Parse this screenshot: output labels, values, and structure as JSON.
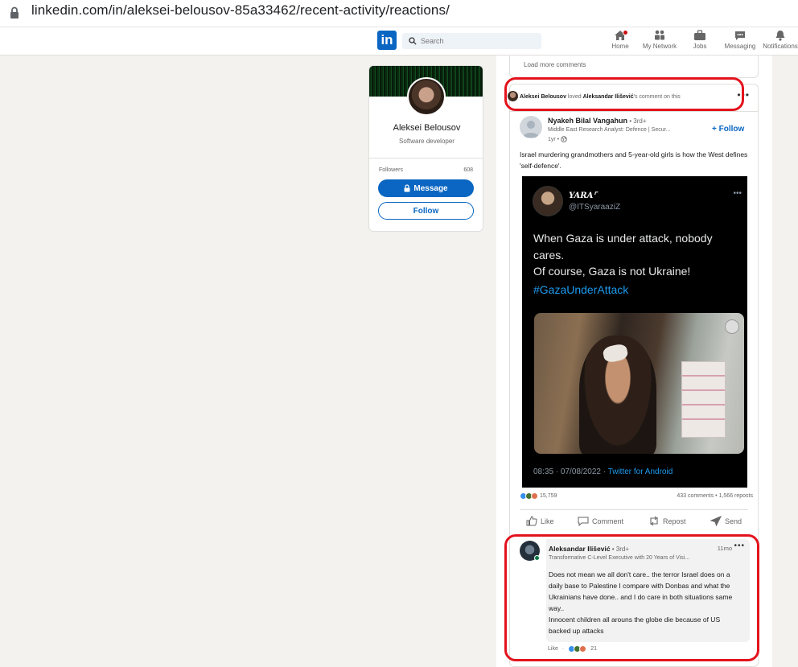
{
  "browser": {
    "url": "linkedin.com/in/aleksei-belousov-85a33462/recent-activity/reactions/"
  },
  "nav": {
    "search_placeholder": "Search",
    "items": [
      {
        "label": "Home",
        "icon": "home-icon"
      },
      {
        "label": "My Network",
        "icon": "network-icon"
      },
      {
        "label": "Jobs",
        "icon": "briefcase-icon"
      },
      {
        "label": "Messaging",
        "icon": "messaging-icon"
      },
      {
        "label": "Notifications",
        "icon": "bell-icon"
      }
    ]
  },
  "profile": {
    "name": "Aleksei Belousov",
    "headline": "Software developer",
    "followers_label": "Followers",
    "followers_count": "608",
    "message_label": "Message",
    "follow_label": "Follow"
  },
  "feed": {
    "load_more": "Load more comments",
    "activity": {
      "actor": "Aleksei Belousov",
      "verb": " loved ",
      "target": "Aleksandar Ilišević",
      "suffix": "'s comment on this"
    },
    "post": {
      "author": "Nyakeh Bilal Vangahun",
      "degree": " • 3rd+",
      "title": "Middle East Research Analyst: Defence | Secur...",
      "time": "1yr •",
      "follow_label": "+ Follow",
      "text": "Israel murdering grandmothers and 5-year-old girls is how the West defines 'self-defence'.",
      "tweet": {
        "name": "YARA⌜",
        "handle": "@ITSyaraaziZ",
        "text": "When Gaza is under attack, nobody cares.\nOf course, Gaza is not Ukraine!",
        "hashtag": "#GazaUnderAttack",
        "timestamp": "08:35 · 07/08/2022 · ",
        "source": "Twitter for Android"
      },
      "reactions_count": "15,759",
      "comments_reposts": "433 comments • 1,566 reposts",
      "actions": {
        "like": "Like",
        "comment": "Comment",
        "repost": "Repost",
        "send": "Send"
      }
    },
    "comment": {
      "author": "Aleksandar Ilišević",
      "degree": " • 3rd+",
      "title": "Transformative C-Level Executive with 20 Years of Visi...",
      "time": "11mo",
      "text": "Does not mean we all don't care.. the terror Israel does on a daily base to Palestine I compare with Donbas and what the Ukrainians have done.. and I do care in both situations same way..\nInnocent children all arouns the globe die because of US backed up attacks",
      "like_label": "Like",
      "separator": "·",
      "reactions_count": "21"
    }
  },
  "colors": {
    "linkedin_blue": "#0a66c2",
    "highlight_red": "#e3131d",
    "background": "#f3f2ef"
  }
}
